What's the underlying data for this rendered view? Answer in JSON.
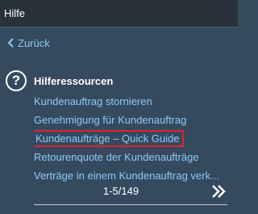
{
  "header": {
    "title": "Hilfe"
  },
  "back": {
    "label": "Zurück",
    "icon": "chevron-left-icon"
  },
  "resources": {
    "icon": "question-circle-icon",
    "title": "Hilferessourcen",
    "items": [
      {
        "label": "Kundenauftrag stornieren"
      },
      {
        "label": "Genehmigung für Kundenauftrag"
      },
      {
        "label": "Kundenaufträge – Quick Guide",
        "highlighted": true
      },
      {
        "label": "Retourenquote der Kundenaufträge"
      },
      {
        "label": "Verträge in einem Kundenauftrag verk..."
      }
    ]
  },
  "pager": {
    "text": "1-5/149",
    "next_icon": "double-chevron-right-icon"
  },
  "colors": {
    "background": "#354a5f",
    "header": "#29313a",
    "link": "#91c8f6",
    "highlight_border": "#e0222a"
  }
}
